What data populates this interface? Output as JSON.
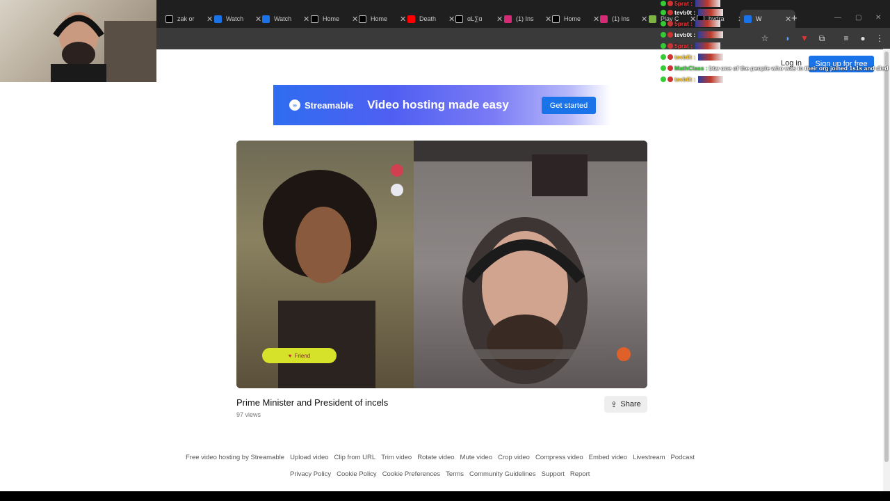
{
  "browser": {
    "tabs": [
      {
        "label": "zak or",
        "icon": "x-icon",
        "color": "#000000"
      },
      {
        "label": "Watch",
        "icon": "streamable-icon",
        "color": "#1a73e8"
      },
      {
        "label": "Watch",
        "icon": "streamable-icon",
        "color": "#1a73e8"
      },
      {
        "label": "Home",
        "icon": "x-icon",
        "color": "#000000"
      },
      {
        "label": "Home",
        "icon": "x-icon",
        "color": "#000000"
      },
      {
        "label": "Death",
        "icon": "youtube-icon",
        "color": "#ff0000"
      },
      {
        "label": "ɑL∑ɑ",
        "icon": "x-icon",
        "color": "#000000"
      },
      {
        "label": "(1) Ins",
        "icon": "instagram-icon",
        "color": "#d62976"
      },
      {
        "label": "Home",
        "icon": "x-icon",
        "color": "#000000"
      },
      {
        "label": "(1) Ins",
        "icon": "instagram-icon",
        "color": "#d62976"
      },
      {
        "label": "Play C",
        "icon": "game-icon",
        "color": "#7cb342"
      },
      {
        "label": "hydra",
        "icon": "x-icon",
        "color": "#000000"
      },
      {
        "label": "W",
        "icon": "streamable-icon",
        "color": "#1a73e8",
        "active": true
      }
    ],
    "new_tab": "+"
  },
  "chat": {
    "lines": [
      {
        "user": "5prat",
        "color": "#ff3333",
        "text": ""
      },
      {
        "user": "tevb0t",
        "color": "#ffffff",
        "text": ""
      },
      {
        "user": "5prat",
        "color": "#ff3333",
        "text": ""
      },
      {
        "user": "tevb0t",
        "color": "#ffffff",
        "text": ""
      },
      {
        "user": "5prat",
        "color": "#ff3333",
        "text": ""
      },
      {
        "user": "tevb0t",
        "color": "#ffcc33",
        "text": ""
      },
      {
        "user": "MathClass",
        "color": "#33cc33",
        "text": "btw one of the people who was in their org joined 1s1s and died"
      },
      {
        "user": "tevb0t",
        "color": "#ffcc33",
        "text": ""
      }
    ]
  },
  "header": {
    "login": "Log in",
    "signup": "Sign up for free"
  },
  "banner": {
    "brand": "Streamable",
    "tagline": "Video hosting made easy",
    "cta": "Get started"
  },
  "video": {
    "friend_button": "Friend",
    "title": "Prime Minister and President of incels",
    "views": "97 views",
    "share": "Share"
  },
  "footer": {
    "row1": [
      "Free video hosting by Streamable",
      "Upload video",
      "Clip from URL",
      "Trim video",
      "Rotate video",
      "Mute video",
      "Crop video",
      "Compress video",
      "Embed video",
      "Livestream",
      "Podcast"
    ],
    "row2": [
      "Privacy Policy",
      "Cookie Policy",
      "Cookie Preferences",
      "Terms",
      "Community Guidelines",
      "Support",
      "Report"
    ]
  }
}
